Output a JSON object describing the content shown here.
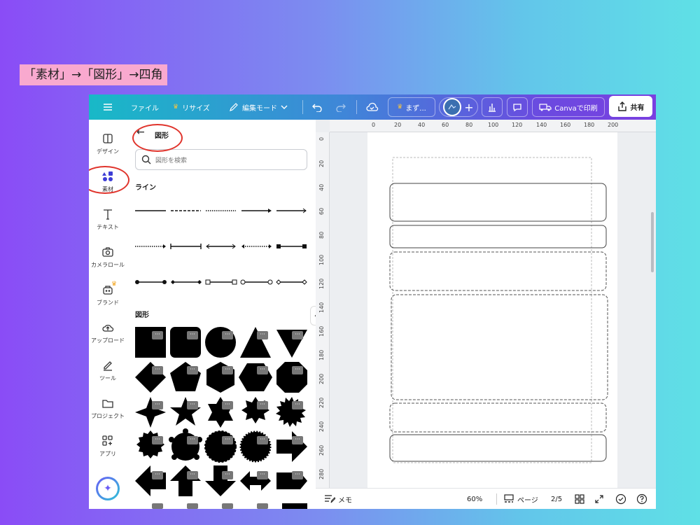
{
  "caption": "「素材」→「図形」→四角",
  "topbar": {
    "menu_icon": "hamburger-icon",
    "file": "ファイル",
    "resize": "リサイズ",
    "edit_mode": "編集モード",
    "project_name": "まず...",
    "print": "Canvaで印刷",
    "share": "共有"
  },
  "rail": {
    "items": [
      {
        "label": "デザイン",
        "icon": "layout-icon"
      },
      {
        "label": "素材",
        "icon": "elements-icon"
      },
      {
        "label": "テキスト",
        "icon": "text-icon"
      },
      {
        "label": "カメラロール",
        "icon": "camera-icon"
      },
      {
        "label": "ブランド",
        "icon": "brand-icon"
      },
      {
        "label": "アップロード",
        "icon": "upload-icon"
      },
      {
        "label": "ツール",
        "icon": "pen-icon"
      },
      {
        "label": "プロジェクト",
        "icon": "folder-icon"
      },
      {
        "label": "アプリ",
        "icon": "apps-icon"
      }
    ]
  },
  "panel": {
    "title": "図形",
    "search_placeholder": "図形を検索",
    "lines_heading": "ライン",
    "shapes_heading": "図形",
    "more_label": "···"
  },
  "ruler": {
    "top": [
      "0",
      "20",
      "40",
      "60",
      "80",
      "100",
      "120",
      "140",
      "160",
      "180",
      "200"
    ],
    "left": [
      "0",
      "20",
      "40",
      "60",
      "80",
      "100",
      "120",
      "140",
      "160",
      "180",
      "200",
      "220",
      "240",
      "260",
      "280"
    ]
  },
  "bottombar": {
    "notes": "メモ",
    "zoom": "60%",
    "pages": "ページ",
    "page_indicator": "2/5"
  },
  "colors": {
    "accent": "#7a3fe0",
    "annotation": "#e0342c",
    "caption_bg": "#f9a9cf"
  }
}
